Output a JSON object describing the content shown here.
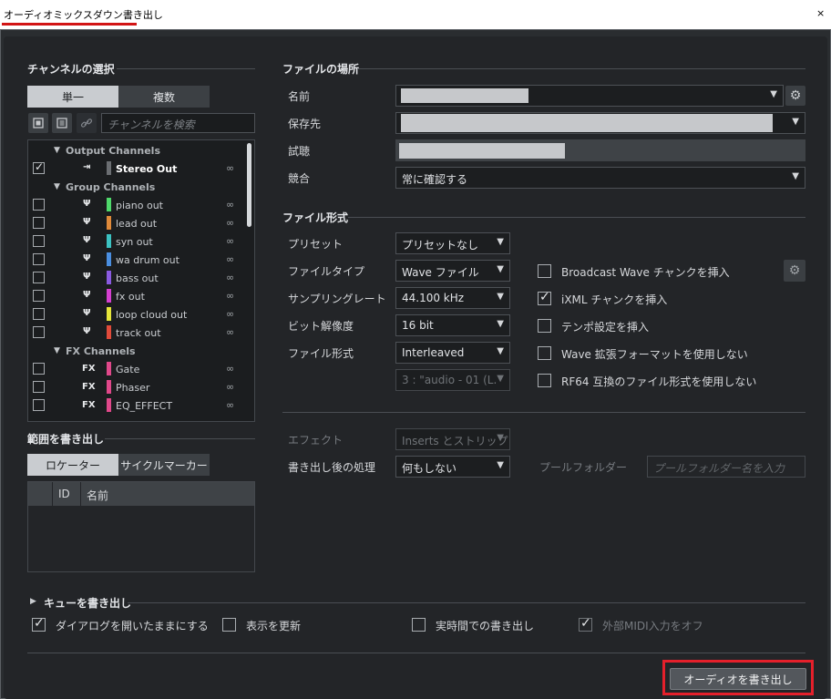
{
  "window": {
    "title": "オーディオミックスダウン書き出し",
    "close": "×"
  },
  "channel_select": {
    "section_title": "チャンネルの選択",
    "tabs": [
      "単一",
      "複数"
    ],
    "search_placeholder": "チャンネルを検索",
    "groups": [
      {
        "name": "Output Channels",
        "items": [
          {
            "name": "Stereo Out",
            "checked": true,
            "color": "#6b6e72"
          }
        ]
      },
      {
        "name": "Group Channels",
        "items": [
          {
            "name": "piano out",
            "checked": false,
            "color": "#4fd96b"
          },
          {
            "name": "lead out",
            "checked": false,
            "color": "#e08a3a"
          },
          {
            "name": "syn out",
            "checked": false,
            "color": "#3cc2c2"
          },
          {
            "name": "wa drum out",
            "checked": false,
            "color": "#4a8ee0"
          },
          {
            "name": "bass out",
            "checked": false,
            "color": "#8a5ae0"
          },
          {
            "name": "fx out",
            "checked": false,
            "color": "#d53fd0"
          },
          {
            "name": "loop cloud out",
            "checked": false,
            "color": "#e6e63a"
          },
          {
            "name": "track out",
            "checked": false,
            "color": "#e04a3a"
          }
        ]
      },
      {
        "name": "FX Channels",
        "items": [
          {
            "name": "Gate",
            "checked": false,
            "color": "#e0488a"
          },
          {
            "name": "Phaser",
            "checked": false,
            "color": "#e0488a"
          },
          {
            "name": "EQ_EFFECT",
            "checked": false,
            "color": "#e0488a"
          }
        ]
      }
    ],
    "fx_icon": "FX"
  },
  "range": {
    "section_title": "範囲を書き出し",
    "tabs": [
      "ロケーター",
      "サイクルマーカー"
    ],
    "columns": [
      "ID",
      "名前"
    ]
  },
  "file_location": {
    "section_title": "ファイルの場所",
    "name_label": "名前",
    "save_label": "保存先",
    "audition_label": "試聴",
    "conflict_label": "競合",
    "conflict_value": "常に確認する"
  },
  "file_format": {
    "section_title": "ファイル形式",
    "preset_label": "プリセット",
    "preset_value": "プリセットなし",
    "filetype_label": "ファイルタイプ",
    "filetype_value": "Wave ファイル",
    "samplerate_label": "サンプリングレート",
    "samplerate_value": "44.100 kHz",
    "bitdepth_label": "ビット解像度",
    "bitdepth_value": "16 bit",
    "format_label": "ファイル形式",
    "format_value": "Interleaved",
    "channel_value": "3 : \"audio - 01 (L.",
    "options": [
      {
        "label": "Broadcast Wave チャンクを挿入",
        "checked": false
      },
      {
        "label": "iXML チャンクを挿入",
        "checked": true
      },
      {
        "label": "テンポ設定を挿入",
        "checked": false
      },
      {
        "label": "Wave 拡張フォーマットを使用しない",
        "checked": false
      },
      {
        "label": "RF64 互換のファイル形式を使用しない",
        "checked": false
      }
    ]
  },
  "post": {
    "effect_label": "エフェクト",
    "effect_value": "Inserts とストリップ",
    "after_label": "書き出し後の処理",
    "after_value": "何もしない",
    "pool_label": "プールフォルダー",
    "pool_placeholder": "プールフォルダー名を入力"
  },
  "queue": {
    "title": "キューを書き出し",
    "options": [
      {
        "label": "ダイアログを開いたままにする",
        "checked": true
      },
      {
        "label": "表示を更新",
        "checked": false
      },
      {
        "label": "実時間での書き出し",
        "checked": false
      },
      {
        "label": "外部MIDI入力をオフ",
        "checked": true
      }
    ]
  },
  "export_button": "オーディオを書き出し"
}
